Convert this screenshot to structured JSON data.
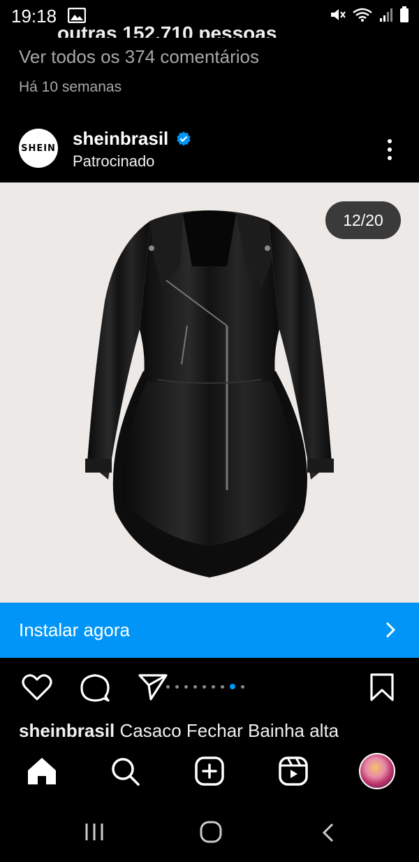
{
  "status_bar": {
    "time": "19:18"
  },
  "feed": {
    "cut_off_text": "outras 152.710 pessoas",
    "comments_link": "Ver todos os 374 comentários",
    "time_ago": "Há 10 semanas"
  },
  "post": {
    "avatar_text": "SHEIN",
    "username": "sheinbrasil",
    "sponsored_label": "Patrocinado",
    "carousel_counter": "12/20",
    "cta_label": "Instalar agora",
    "caption_user": "sheinbrasil",
    "caption_text": "Casaco Fechar Bainha alta",
    "carousel_dots": {
      "count": 9,
      "active_index": 7
    }
  },
  "colors": {
    "background": "#000000",
    "cta": "#0095f6",
    "media_bg": "#ede9e6",
    "verified": "#0095f6"
  },
  "icons": {
    "action_row": [
      "heart-icon",
      "comment-icon",
      "share-icon",
      "bookmark-icon"
    ],
    "tab_bar": [
      "home-icon",
      "search-icon",
      "create-icon",
      "reels-icon",
      "profile-avatar"
    ],
    "system_nav": [
      "recents-icon",
      "home-circle-icon",
      "back-icon"
    ]
  }
}
